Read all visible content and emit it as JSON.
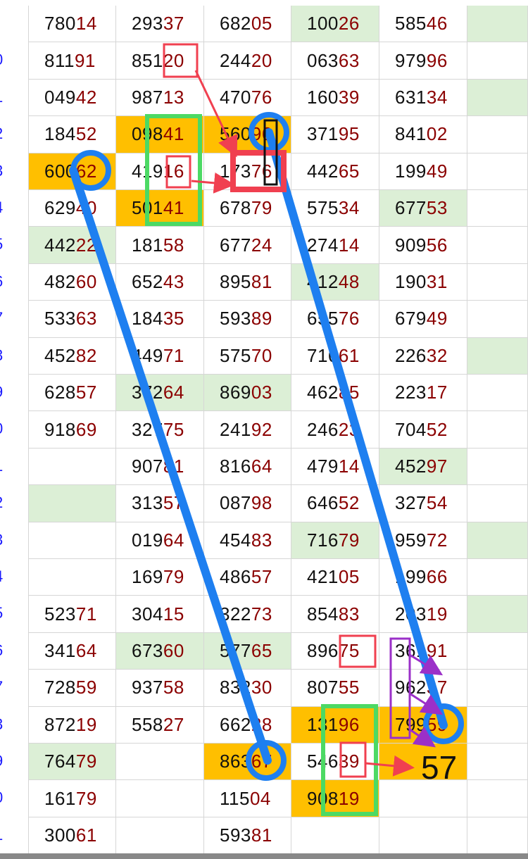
{
  "row_labels": [
    "",
    "0",
    "1",
    "2",
    "3",
    "4",
    "5",
    "6",
    "7",
    "3",
    "9",
    "0",
    "1",
    "2",
    "3",
    "4",
    "5",
    "6",
    "7",
    "3",
    "9",
    "0",
    "1"
  ],
  "rows": [
    [
      "78014",
      "29337",
      "68205",
      "10026",
      "58546",
      ""
    ],
    [
      "81191",
      "85120",
      "24420",
      "06363",
      "97996",
      ""
    ],
    [
      "04942",
      "98713",
      "47076",
      "16039",
      "63134",
      ""
    ],
    [
      "18452",
      "09841",
      "56096",
      "37195",
      "84102",
      ""
    ],
    [
      "60062",
      "41916",
      "17376",
      "44265",
      "19949",
      ""
    ],
    [
      "62940",
      "50141",
      "67879",
      "57534",
      "67753",
      ""
    ],
    [
      "44222",
      "18158",
      "67724",
      "27414",
      "90956",
      ""
    ],
    [
      "48260",
      "65243",
      "89581",
      "41248",
      "19031",
      ""
    ],
    [
      "53363",
      "18435",
      "59389",
      "65576",
      "67949",
      ""
    ],
    [
      "45282",
      "44971",
      "57570",
      "71661",
      "22632",
      ""
    ],
    [
      "62857",
      "37264",
      "86903",
      "46285",
      "22317",
      ""
    ],
    [
      "91869",
      "32775",
      "24192",
      "24623",
      "70452",
      ""
    ],
    [
      "",
      "90781",
      "81664",
      "47914",
      "45297",
      ""
    ],
    [
      "",
      "31357",
      "08798",
      "64652",
      "32754",
      ""
    ],
    [
      "",
      "01964",
      "45483",
      "71679",
      "95972",
      ""
    ],
    [
      "",
      "16979",
      "48657",
      "42105",
      "19966",
      ""
    ],
    [
      "52371",
      "30415",
      "32273",
      "85483",
      "20319",
      ""
    ],
    [
      "34164",
      "67360",
      "57765",
      "89675",
      "36191",
      ""
    ],
    [
      "72859",
      "93758",
      "83230",
      "80755",
      "96237",
      ""
    ],
    [
      "87219",
      "55827",
      "66228",
      "13196",
      "79959",
      ""
    ],
    [
      "76479",
      "",
      "86367",
      "54639",
      "",
      ""
    ],
    [
      "16179",
      "",
      "11504",
      "90819",
      "",
      ""
    ],
    [
      "30061",
      "",
      "59381",
      "",
      "",
      ""
    ]
  ],
  "fills": [
    [
      "",
      "",
      "",
      "green",
      "",
      "green"
    ],
    [
      "",
      "",
      "",
      "",
      "",
      ""
    ],
    [
      "",
      "",
      "",
      "",
      "",
      "green"
    ],
    [
      "",
      "orange",
      "orange",
      "",
      "",
      ""
    ],
    [
      "orange",
      "",
      "",
      "",
      "",
      ""
    ],
    [
      "",
      "orange",
      "",
      "",
      "green",
      ""
    ],
    [
      "green",
      "",
      "",
      "",
      "",
      ""
    ],
    [
      "",
      "",
      "",
      "green",
      "",
      ""
    ],
    [
      "",
      "",
      "",
      "",
      "",
      ""
    ],
    [
      "",
      "",
      "",
      "",
      "",
      "green"
    ],
    [
      "",
      "green",
      "green",
      "",
      "",
      ""
    ],
    [
      "",
      "",
      "",
      "",
      "",
      ""
    ],
    [
      "",
      "",
      "",
      "",
      "green",
      ""
    ],
    [
      "green",
      "",
      "",
      "",
      "",
      ""
    ],
    [
      "",
      "",
      "",
      "green",
      "",
      "green"
    ],
    [
      "",
      "",
      "",
      "",
      "",
      ""
    ],
    [
      "",
      "",
      "",
      "",
      "",
      "green"
    ],
    [
      "",
      "green",
      "green",
      "",
      "",
      ""
    ],
    [
      "",
      "",
      "",
      "",
      "",
      ""
    ],
    [
      "",
      "",
      "",
      "orange",
      "orange",
      ""
    ],
    [
      "green",
      "",
      "orange",
      "",
      "orange",
      ""
    ],
    [
      "",
      "",
      "",
      "orange",
      "",
      ""
    ],
    [
      "",
      "",
      "",
      "",
      "",
      ""
    ]
  ],
  "annotation_text": "57",
  "colors": {
    "orange": "#ffbf00",
    "green": "#dcefd6",
    "blue_line": "#1e7ff0",
    "red": "#f04050",
    "green_box": "#4cd964",
    "purple": "#9b30c8",
    "digit_dark": "#111111",
    "digit_red": "#8b0000",
    "row_label_blue": "#1a1aff"
  }
}
